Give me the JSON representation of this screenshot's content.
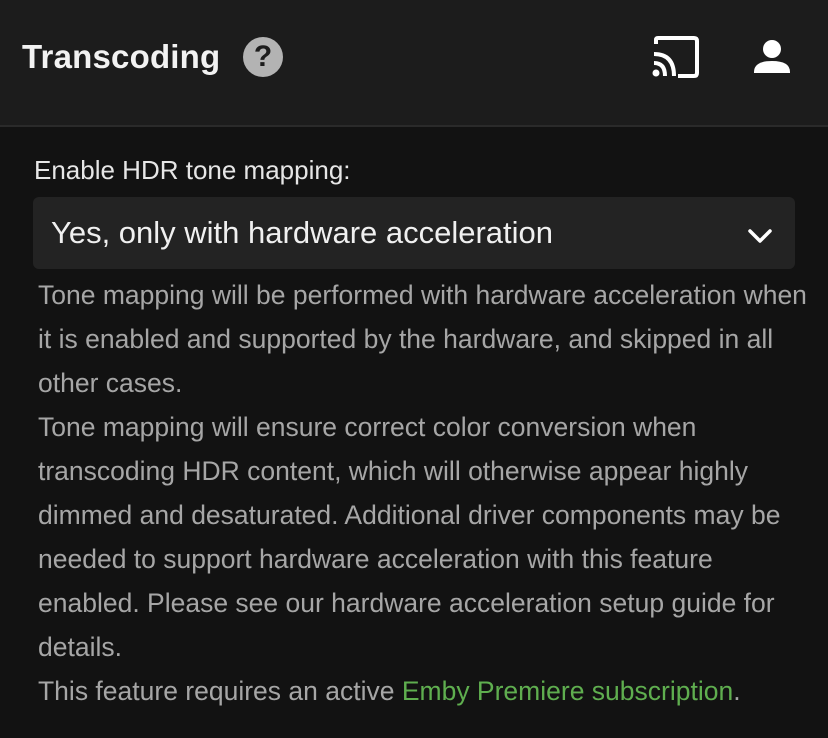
{
  "header": {
    "title": "Transcoding",
    "help_icon": "question-circle-icon",
    "cast_icon": "cast-icon",
    "user_icon": "user-icon"
  },
  "setting": {
    "label": "Enable HDR tone mapping:",
    "selected_value": "Yes, only with hardware acceleration",
    "chevron_icon": "chevron-down-icon",
    "description_1": "Tone mapping will be performed with hardware acceleration when it is enabled and supported by the hardware, and skipped in all other cases.",
    "description_2": "Tone mapping will ensure correct color conversion when transcoding HDR content, which will otherwise appear highly dimmed and desaturated. Additional driver components may be needed to support hardware acceleration with this feature enabled. Please see our hardware acceleration setup guide for details.",
    "premiere_prefix": "This feature requires an active ",
    "premiere_link": "Emby Premiere subscription",
    "premiere_suffix": "."
  },
  "colors": {
    "background": "#121212",
    "header_bg": "#1c1c1c",
    "select_bg": "#232323",
    "link": "#5fae4f",
    "muted_text": "#a6a6a6"
  }
}
